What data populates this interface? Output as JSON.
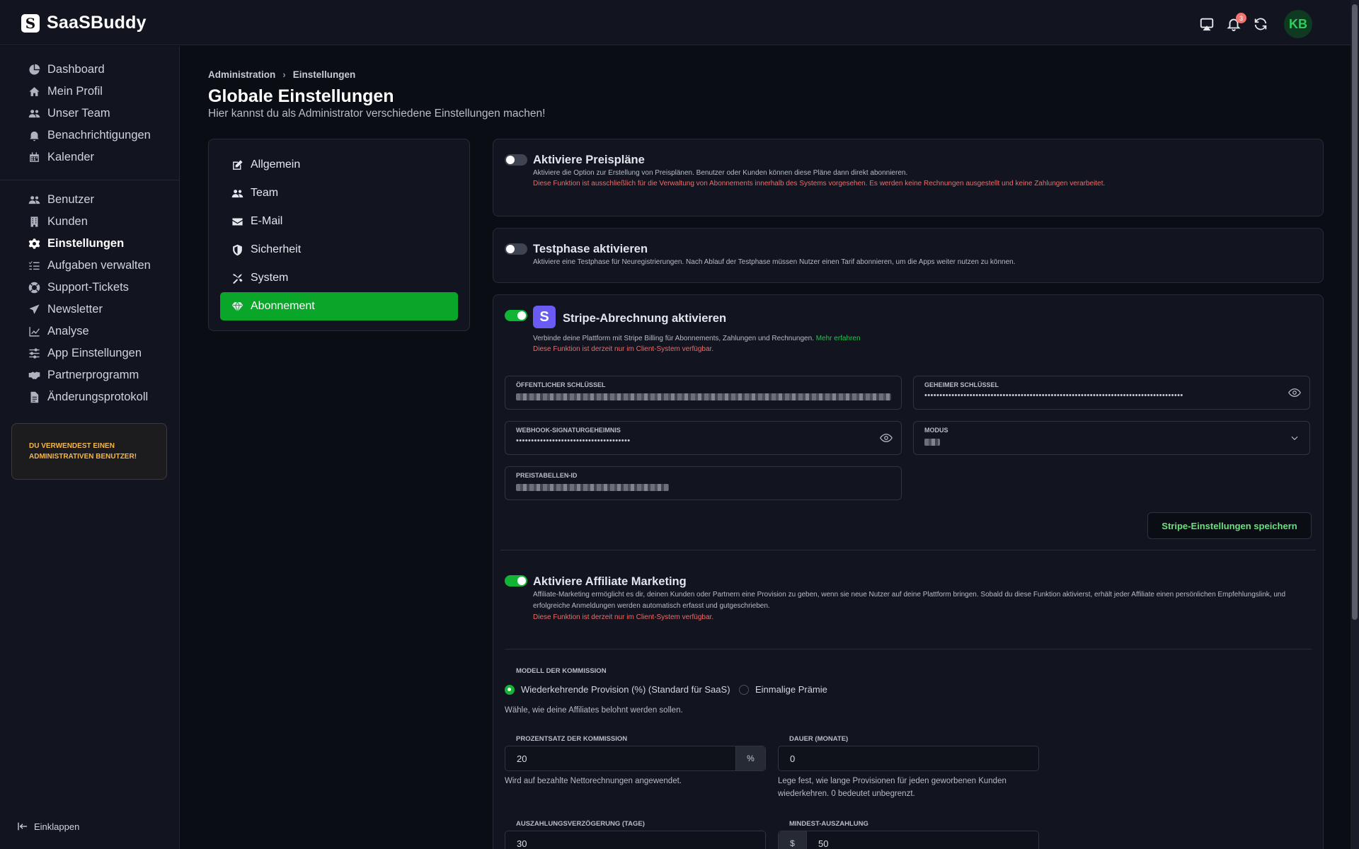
{
  "app": {
    "name": "SaaSBuddy",
    "avatar_initials": "KB",
    "notification_count": "3"
  },
  "sidebar": {
    "group1": [
      {
        "label": "Dashboard"
      },
      {
        "label": "Mein Profil"
      },
      {
        "label": "Unser Team"
      },
      {
        "label": "Benachrichtigungen"
      },
      {
        "label": "Kalender"
      }
    ],
    "group2": [
      {
        "label": "Benutzer"
      },
      {
        "label": "Kunden"
      },
      {
        "label": "Einstellungen"
      },
      {
        "label": "Aufgaben verwalten"
      },
      {
        "label": "Support-Tickets"
      },
      {
        "label": "Newsletter"
      },
      {
        "label": "Analyse"
      },
      {
        "label": "App Einstellungen"
      },
      {
        "label": "Partnerprogramm"
      },
      {
        "label": "Änderungsprotokoll"
      }
    ],
    "admin_notice": "Du verwendest einen administrativen Benutzer!",
    "collapse_label": "Einklappen"
  },
  "breadcrumb": {
    "root": "Administration",
    "current": "Einstellungen"
  },
  "page": {
    "title": "Globale Einstellungen",
    "subtitle": "Hier kannst du als Administrator verschiedene Einstellungen machen!"
  },
  "settings_nav": [
    {
      "label": "Allgemein"
    },
    {
      "label": "Team"
    },
    {
      "label": "E-Mail"
    },
    {
      "label": "Sicherheit"
    },
    {
      "label": "System"
    },
    {
      "label": "Abonnement"
    }
  ],
  "pricing": {
    "title": "Aktiviere Preispläne",
    "desc": "Aktiviere die Option zur Erstellung von Preisplänen. Benutzer oder Kunden können diese Pläne dann direkt abonnieren.",
    "warn": "Diese Funktion ist ausschließlich für die Verwaltung von Abonnements innerhalb des Systems vorgesehen. Es werden keine Rechnungen ausgestellt und keine Zahlungen verarbeitet."
  },
  "trial": {
    "title": "Testphase aktivieren",
    "desc": "Aktiviere eine Testphase für Neuregistrierungen. Nach Ablauf der Testphase müssen Nutzer einen Tarif abonnieren, um die Apps weiter nutzen zu können."
  },
  "stripe": {
    "logo_letter": "S",
    "title": "Stripe-Abrechnung aktivieren",
    "desc": "Verbinde deine Plattform mit Stripe Billing für Abonnements, Zahlungen und Rechnungen.",
    "link": "Mehr erfahren",
    "warn": "Diese Funktion ist derzeit nur im Client-System verfügbar.",
    "public_key_label": "Öffentlicher Schlüssel",
    "secret_key_label": "Geheimer Schlüssel",
    "secret_key_value": "••••••••••••••••••••••••••••••••••••••••••••••••••••••••••••••••••••••••••••••••••••••",
    "webhook_label": "Webhook-Signaturgeheimnis",
    "webhook_value": "••••••••••••••••••••••••••••••••••••••",
    "mode_label": "Modus",
    "pricing_table_label": "Preistabellen-ID",
    "save_label": "Stripe-Einstellungen speichern"
  },
  "affiliate": {
    "title": "Aktiviere Affiliate Marketing",
    "desc": "Affiliate-Marketing ermöglicht es dir, deinen Kunden oder Partnern eine Provision zu geben, wenn sie neue Nutzer auf deine Plattform bringen. Sobald du diese Funktion aktivierst, erhält jeder Affiliate einen persönlichen Empfehlungslink, und erfolgreiche Anmeldungen werden automatisch erfasst und gutgeschrieben.",
    "warn": "Diese Funktion ist derzeit nur im Client-System verfügbar.",
    "model_label": "Modell der Kommission",
    "option_recurring": "Wiederkehrende Provision (%) (Standard für SaaS)",
    "option_onetime": "Einmalige Prämie",
    "model_hint": "Wähle, wie deine Affiliates belohnt werden sollen.",
    "percent_label": "Prozentsatz der Kommission",
    "percent_value": "20",
    "percent_unit": "%",
    "percent_hint": "Wird auf bezahlte Nettorechnungen angewendet.",
    "duration_label": "Dauer (Monate)",
    "duration_value": "0",
    "duration_hint": "Lege fest, wie lange Provisionen für jeden geworbenen Kunden wiederkehren. 0 bedeutet unbegrenzt.",
    "delay_label": "Auszahlungsverzögerung (Tage)",
    "delay_value": "30",
    "min_payout_label": "Mindest-Auszahlung",
    "min_payout_currency": "$",
    "min_payout_value": "50"
  }
}
